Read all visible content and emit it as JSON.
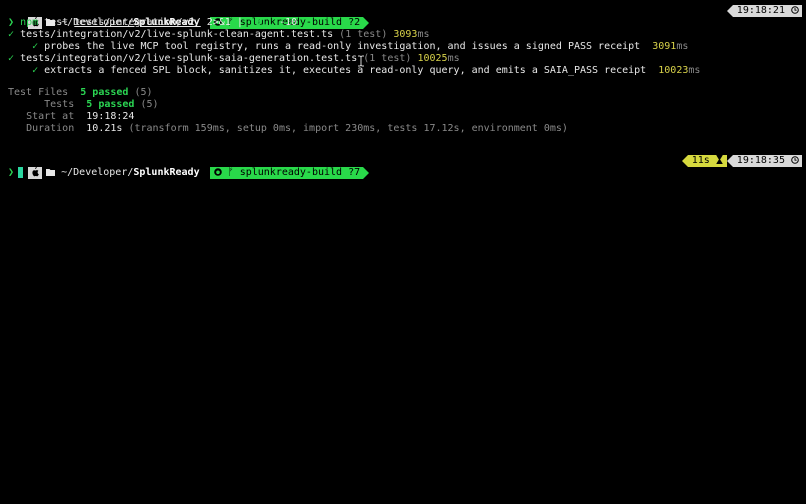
{
  "prompt1": {
    "os_icon": "apple-icon",
    "folder_icon": "folder-icon",
    "dir_prefix": "~/Developer/",
    "dir_name": "SplunkReady",
    "git_icon": "github-icon",
    "branch_icon": "branch-icon",
    "branch": "splunkready-build",
    "git_status": "?2",
    "time": "19:18:21",
    "clock_icon": "clock-icon"
  },
  "command": {
    "chevron": "❯",
    "cmd": "npm",
    "arg1": "test",
    "path": "tests/integration/v2/",
    "redirect": "2>&1",
    "pipe": "|",
    "cmd2": "tail",
    "arg2": "-10"
  },
  "results": [
    {
      "check": "✓",
      "file": "tests/integration/v2/live-splunk-clean-agent.test.ts",
      "count": "(1 test)",
      "time_value": "3093",
      "time_unit": "ms",
      "subtest": {
        "check": "✓",
        "name": "probes the live MCP tool registry, runs a read-only investigation, and issues a signed PASS receipt",
        "time_value": "3091",
        "time_unit": "ms"
      }
    },
    {
      "check": "✓",
      "file": "tests/integration/v2/live-splunk-saia-generation.test.ts",
      "count": "(1 test)",
      "time_value": "10025",
      "time_unit": "ms",
      "subtest": {
        "check": "✓",
        "name": "extracts a fenced SPL block, sanitizes it, executes a read-only query, and emits a SAIA_PASS receipt",
        "time_value": "10023",
        "time_unit": "ms"
      }
    }
  ],
  "summary": {
    "test_files_label": "Test Files",
    "test_files_value": "5 passed",
    "test_files_count": "(5)",
    "tests_label": "Tests",
    "tests_value": "5 passed",
    "tests_count": "(5)",
    "start_label": "Start at",
    "start_value": "19:18:24",
    "duration_label": "Duration",
    "duration_value": "10.21s",
    "duration_detail": "(transform 159ms, setup 0ms, import 230ms, tests 17.12s, environment 0ms)"
  },
  "prompt2": {
    "dir_prefix": "~/Developer/",
    "dir_name": "SplunkReady",
    "branch": "splunkready-build",
    "git_status": "?7",
    "duration": "11s",
    "hourglass_icon": "hourglass-icon",
    "time": "19:18:35"
  },
  "input_prompt": {
    "chevron": "❯"
  }
}
